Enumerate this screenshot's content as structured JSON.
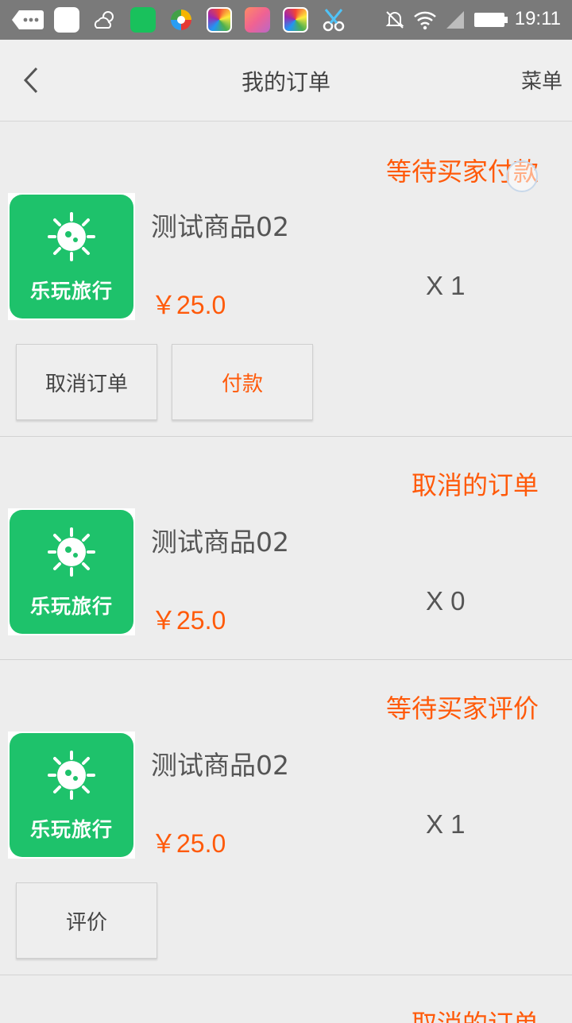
{
  "status_bar": {
    "time": "19:11",
    "icons": [
      "message-icon",
      "app-blank-icon",
      "weather-icon",
      "shop-bag-icon",
      "browser-icon",
      "app-colorful-icon",
      "app-store-icon",
      "app-colorful-icon",
      "scissors-icon",
      "mute-icon",
      "wifi-icon",
      "signal-icon",
      "battery-icon"
    ],
    "colors": {
      "bar": "#7a7a7a",
      "shop": "#19c15c"
    }
  },
  "header": {
    "title": "我的订单",
    "menu_label": "菜单",
    "back_icon": "chevron-left-icon"
  },
  "accent_color": "#ff5a0a",
  "orders": [
    {
      "status": "等待买家付款",
      "product_name": "测试商品02",
      "price": "￥25.0",
      "quantity": "X 1",
      "logo_text": "乐玩旅行",
      "buttons": [
        "取消订单",
        "付款"
      ]
    },
    {
      "status": "取消的订单",
      "product_name": "测试商品02",
      "price": "￥25.0",
      "quantity": "X 0",
      "logo_text": "乐玩旅行",
      "buttons": []
    },
    {
      "status": "等待买家评价",
      "product_name": "测试商品02",
      "price": "￥25.0",
      "quantity": "X 1",
      "logo_text": "乐玩旅行",
      "buttons": [
        "评价"
      ]
    },
    {
      "status": "取消的订单"
    }
  ]
}
